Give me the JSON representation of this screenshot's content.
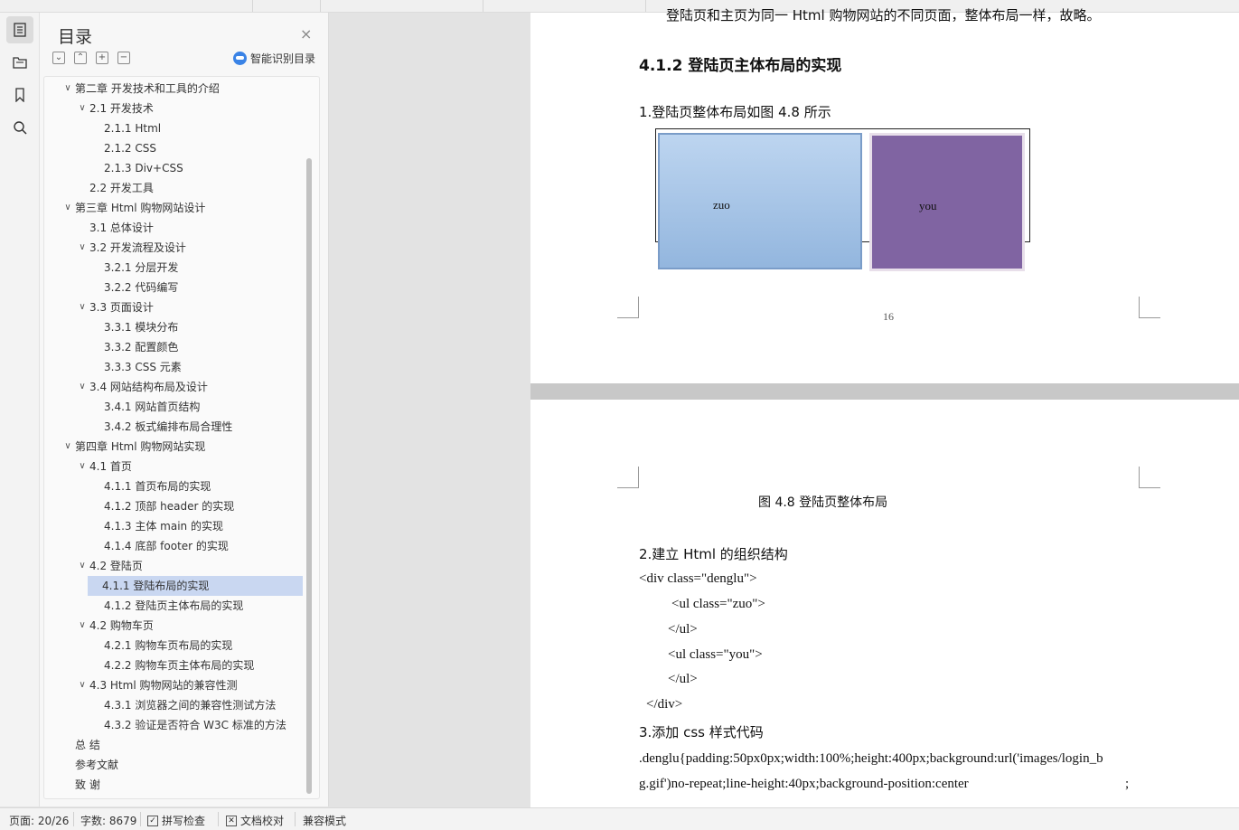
{
  "toc": {
    "title": "目录",
    "close": "×",
    "smart_label": "智能识别目录",
    "tools": [
      "⌄",
      "⌃",
      "+",
      "−"
    ],
    "items": [
      {
        "text": "第二章  开发技术和工具的介绍",
        "level": 0,
        "arrow": true
      },
      {
        "text": "2.1 开发技术",
        "level": 1,
        "arrow": true
      },
      {
        "text": "2.1.1 Html",
        "level": 2,
        "arrow": false
      },
      {
        "text": "2.1.2 CSS",
        "level": 2,
        "arrow": false
      },
      {
        "text": "2.1.3 Div+CSS",
        "level": 2,
        "arrow": false
      },
      {
        "text": "2.2 开发工具",
        "level": 1,
        "arrow": false
      },
      {
        "text": "第三章  Html 购物网站设计",
        "level": 0,
        "arrow": true
      },
      {
        "text": "3.1 总体设计",
        "level": 1,
        "arrow": false
      },
      {
        "text": "3.2 开发流程及设计",
        "level": 1,
        "arrow": true
      },
      {
        "text": "3.2.1  分层开发",
        "level": 2,
        "arrow": false
      },
      {
        "text": "3.2.2  代码编写",
        "level": 2,
        "arrow": false
      },
      {
        "text": "3.3 页面设计",
        "level": 1,
        "arrow": true
      },
      {
        "text": "3.3.1 模块分布",
        "level": 2,
        "arrow": false
      },
      {
        "text": "3.3.2  配置颜色",
        "level": 2,
        "arrow": false
      },
      {
        "text": "3.3.3 CSS 元素",
        "level": 2,
        "arrow": false
      },
      {
        "text": "3.4 网站结构布局及设计",
        "level": 1,
        "arrow": true
      },
      {
        "text": "3.4.1  网站首页结构",
        "level": 2,
        "arrow": false
      },
      {
        "text": "3.4.2  板式编排布局合理性",
        "level": 2,
        "arrow": false
      },
      {
        "text": "第四章  Html 购物网站实现",
        "level": 0,
        "arrow": true
      },
      {
        "text": "4.1 首页",
        "level": 1,
        "arrow": true
      },
      {
        "text": "4.1.1 首页布局的实现",
        "level": 2,
        "arrow": false
      },
      {
        "text": "4.1.2  顶部 header 的实现",
        "level": 2,
        "arrow": false
      },
      {
        "text": "4.1.3  主体 main 的实现",
        "level": 2,
        "arrow": false
      },
      {
        "text": "4.1.4  底部 footer 的实现",
        "level": 2,
        "arrow": false
      },
      {
        "text": "4.2  登陆页",
        "level": 1,
        "arrow": true
      },
      {
        "text": "4.1.1 登陆布局的实现",
        "level": 2,
        "arrow": false,
        "selected": true
      },
      {
        "text": "4.1.2 登陆页主体布局的实现",
        "level": 2,
        "arrow": false
      },
      {
        "text": "4.2  购物车页",
        "level": 1,
        "arrow": true
      },
      {
        "text": "4.2.1 购物车页布局的实现",
        "level": 2,
        "arrow": false
      },
      {
        "text": "4.2.2 购物车页主体布局的实现",
        "level": 2,
        "arrow": false
      },
      {
        "text": "4.3 Html 购物网站的兼容性测",
        "level": 1,
        "arrow": true
      },
      {
        "text": "4.3.1 浏览器之间的兼容性测试方法",
        "level": 2,
        "arrow": false
      },
      {
        "text": "4.3.2 验证是否符合 W3C 标准的方法",
        "level": 2,
        "arrow": false
      },
      {
        "text": "总   结",
        "level": 0,
        "arrow": false
      },
      {
        "text": "参考文献",
        "level": 0,
        "arrow": false
      },
      {
        "text": "致   谢",
        "level": 0,
        "arrow": false
      }
    ]
  },
  "doc": {
    "top_text": "登陆页和主页为同一 Html 购物网站的不同页面，整体布局一样，故略。",
    "heading": "4.1.2 登陆页主体布局的实现",
    "p1": "1.登陆页整体布局如图 4.8 所示",
    "box_left_label": "zuo",
    "box_right_label": "you",
    "page_number": "16",
    "caption": "图 4.8  登陆页整体布局",
    "p2": "2.建立 Html 的组织结构",
    "code": [
      "<div class=\"denglu\">",
      "<ul class=\"zuo\">",
      "</ul>",
      "<ul class=\"you\">",
      "</ul>",
      "</div>"
    ],
    "p3": "3.添加 css 样式代码",
    "css_line1": ".denglu{padding:50px0px;width:100%;height:400px;background:url('images/login_b",
    "css_line2": "g.gif')no-repeat;line-height:40px;background-position:center",
    "css_line2_end": ";",
    "colors": {
      "box_left": "#a9c5e8",
      "box_right": "#8064a2"
    }
  },
  "status": {
    "page": "页面: 20/26",
    "words": "字数: 8679",
    "spell": "拼写检查",
    "proof": "文档校对",
    "compat": "兼容模式"
  }
}
